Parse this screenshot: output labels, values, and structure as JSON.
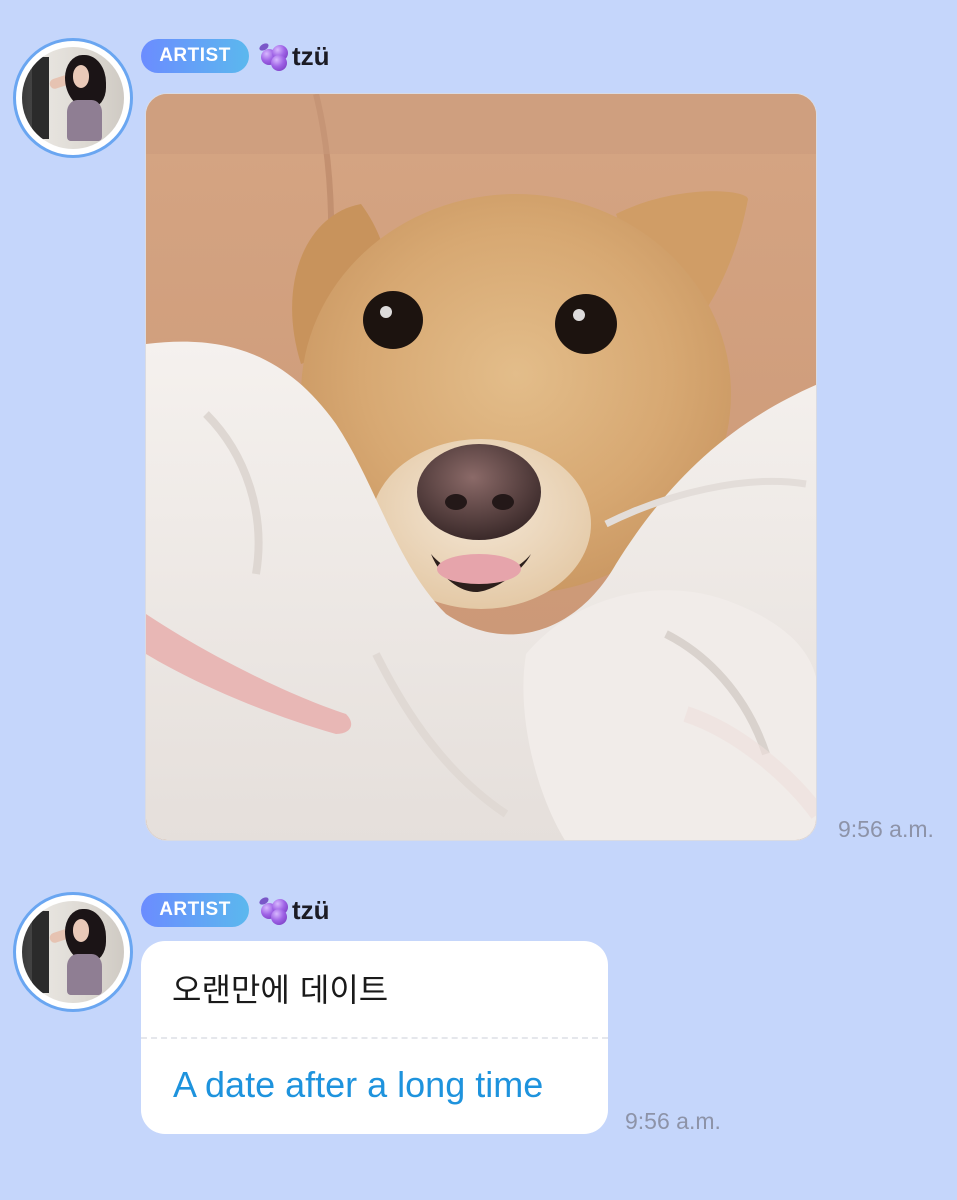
{
  "colors": {
    "background": "#c5d6fb",
    "badge_start": "#6b8cff",
    "badge_end": "#5bb8ee",
    "avatar_ring": "#6aa6f1",
    "translation_text": "#1e93dd",
    "timestamp_text": "#8d93a8"
  },
  "messages": [
    {
      "type": "image",
      "badge": "ARTIST",
      "sender_icon": "grape-emoji-icon",
      "sender": "tzü",
      "image_subject": "dog-photo",
      "time": "9:56 a.m."
    },
    {
      "type": "text",
      "badge": "ARTIST",
      "sender_icon": "grape-emoji-icon",
      "sender": "tzü",
      "original": "오랜만에 데이트",
      "translation": "A date after a long time",
      "time": "9:56 a.m."
    }
  ]
}
